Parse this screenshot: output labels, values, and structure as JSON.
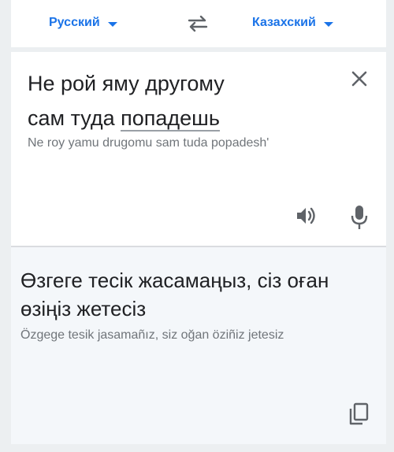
{
  "language_bar": {
    "source_language": "Русский",
    "target_language": "Казахский",
    "swap_icon": "swap-arrows-icon",
    "caret_icon": "caret-down-icon"
  },
  "source": {
    "text_part1": "Не рой яму другому\nсам туда ",
    "text_highlight": "попадешь",
    "transliteration": "Ne roy yamu drugomu sam tuda popadesh'",
    "icons": [
      "close-icon",
      "speaker-icon",
      "microphone-icon"
    ]
  },
  "target": {
    "text": "Өзгеге тесік жасамаңыз, сіз оған өзіңіз жетесіз",
    "transliteration": "Özgege tesik jasamañız, siz oğan öziñiz jetesiz",
    "icons": [
      "copy-icon"
    ]
  },
  "colors": {
    "accent": "#1a73e8",
    "text": "#202124",
    "secondary_text": "#70757a",
    "icon": "#5f6368",
    "target_background": "#f4f7fa"
  }
}
